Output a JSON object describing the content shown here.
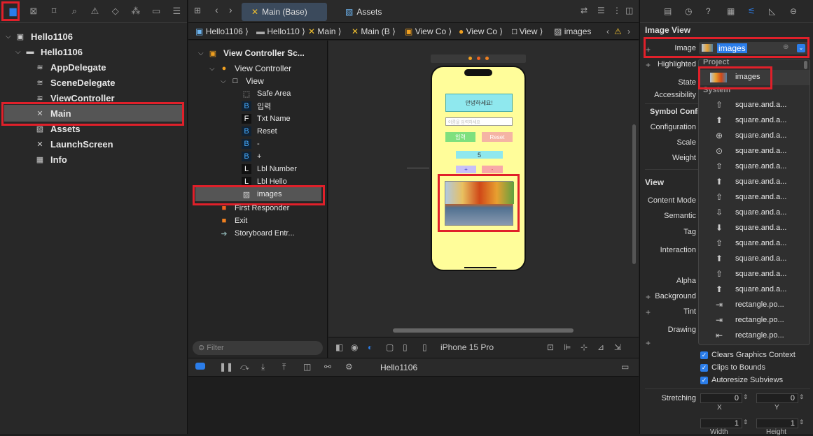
{
  "navigator": {
    "tree": [
      {
        "label": "Hello1106",
        "icon": "app-icon"
      },
      {
        "label": "Hello1106",
        "icon": "folder-icon"
      },
      {
        "label": "AppDelegate",
        "icon": "swift-icon"
      },
      {
        "label": "SceneDelegate",
        "icon": "swift-icon"
      },
      {
        "label": "ViewController",
        "icon": "swift-icon"
      },
      {
        "label": "Main",
        "icon": "storyboard-icon"
      },
      {
        "label": "Assets",
        "icon": "assets-icon"
      },
      {
        "label": "LaunchScreen",
        "icon": "storyboard-icon"
      },
      {
        "label": "Info",
        "icon": "table-icon"
      }
    ],
    "filter_placeholder": "Filter"
  },
  "tabs": [
    {
      "label": "Main (Base)"
    },
    {
      "label": "Assets"
    }
  ],
  "jumpbar": [
    "Hello1106",
    "Hello110",
    "Main",
    "Main (B",
    "View Co",
    "View Co",
    "View",
    "images"
  ],
  "outline": [
    {
      "label": "View Controller Sc...",
      "icon": "scene-icon"
    },
    {
      "label": "View Controller",
      "icon": "vc-icon"
    },
    {
      "label": "View",
      "icon": "view-icon"
    },
    {
      "label": "Safe Area",
      "icon": "safe-area-icon"
    },
    {
      "label": "입력",
      "icon": "button-icon"
    },
    {
      "label": "Txt Name",
      "icon": "textfield-icon"
    },
    {
      "label": "Reset",
      "icon": "button-icon"
    },
    {
      "label": "-",
      "icon": "button-icon"
    },
    {
      "label": "+",
      "icon": "button-icon"
    },
    {
      "label": "Lbl Number",
      "icon": "label-icon"
    },
    {
      "label": "Lbl Hello",
      "icon": "label-icon"
    },
    {
      "label": "images",
      "icon": "imageview-icon"
    },
    {
      "label": "First Responder",
      "icon": "responder-icon"
    },
    {
      "label": "Exit",
      "icon": "exit-icon"
    },
    {
      "label": "Storyboard Entr...",
      "icon": "entry-icon"
    }
  ],
  "phone": {
    "hello": "안녕하세요!",
    "placeholder": "이름을 입력하세요",
    "input_btn": "입력",
    "reset_btn": "Reset",
    "number": "5",
    "plus": "+",
    "minus": "-"
  },
  "canvasbar": {
    "device": "iPhone 15 Pro"
  },
  "debug": {
    "target": "Hello1106"
  },
  "inspector": {
    "section_image_view": "Image View",
    "image_label": "Image",
    "image_value": "images",
    "highlighted": "Highlighted",
    "state": "State",
    "accessibility": "Accessibility",
    "symbol_config": "Symbol Config",
    "configuration": "Configuration",
    "scale": "Scale",
    "weight": "Weight",
    "section_view": "View",
    "content_mode": "Content Mode",
    "semantic": "Semantic",
    "tag": "Tag",
    "interaction": "Interaction",
    "alpha": "Alpha",
    "background": "Background",
    "tint": "Tint",
    "drawing": "Drawing",
    "clears": "Clears Graphics Context",
    "clips": "Clips to Bounds",
    "autoresize": "Autoresize Subviews",
    "stretching": "Stretching",
    "x_label": "X",
    "y_label": "Y",
    "x_val": "0",
    "y_val": "0",
    "w_label": "Width",
    "h_label": "Height",
    "w_val": "1",
    "h_val": "1"
  },
  "dropdown": {
    "project_header": "Project",
    "project_item": "images",
    "system_header": "System",
    "items": [
      "square.and.a...",
      "square.and.a...",
      "square.and.a...",
      "square.and.a...",
      "square.and.a...",
      "square.and.a...",
      "square.and.a...",
      "square.and.a...",
      "square.and.a...",
      "square.and.a...",
      "square.and.a...",
      "square.and.a...",
      "square.and.a...",
      "rectangle.po...",
      "rectangle.po...",
      "rectangle.po..."
    ]
  },
  "colors": {
    "accent": "#2b7de9",
    "highlight": "#e0202a",
    "phone_bg": "#fffd9a"
  }
}
